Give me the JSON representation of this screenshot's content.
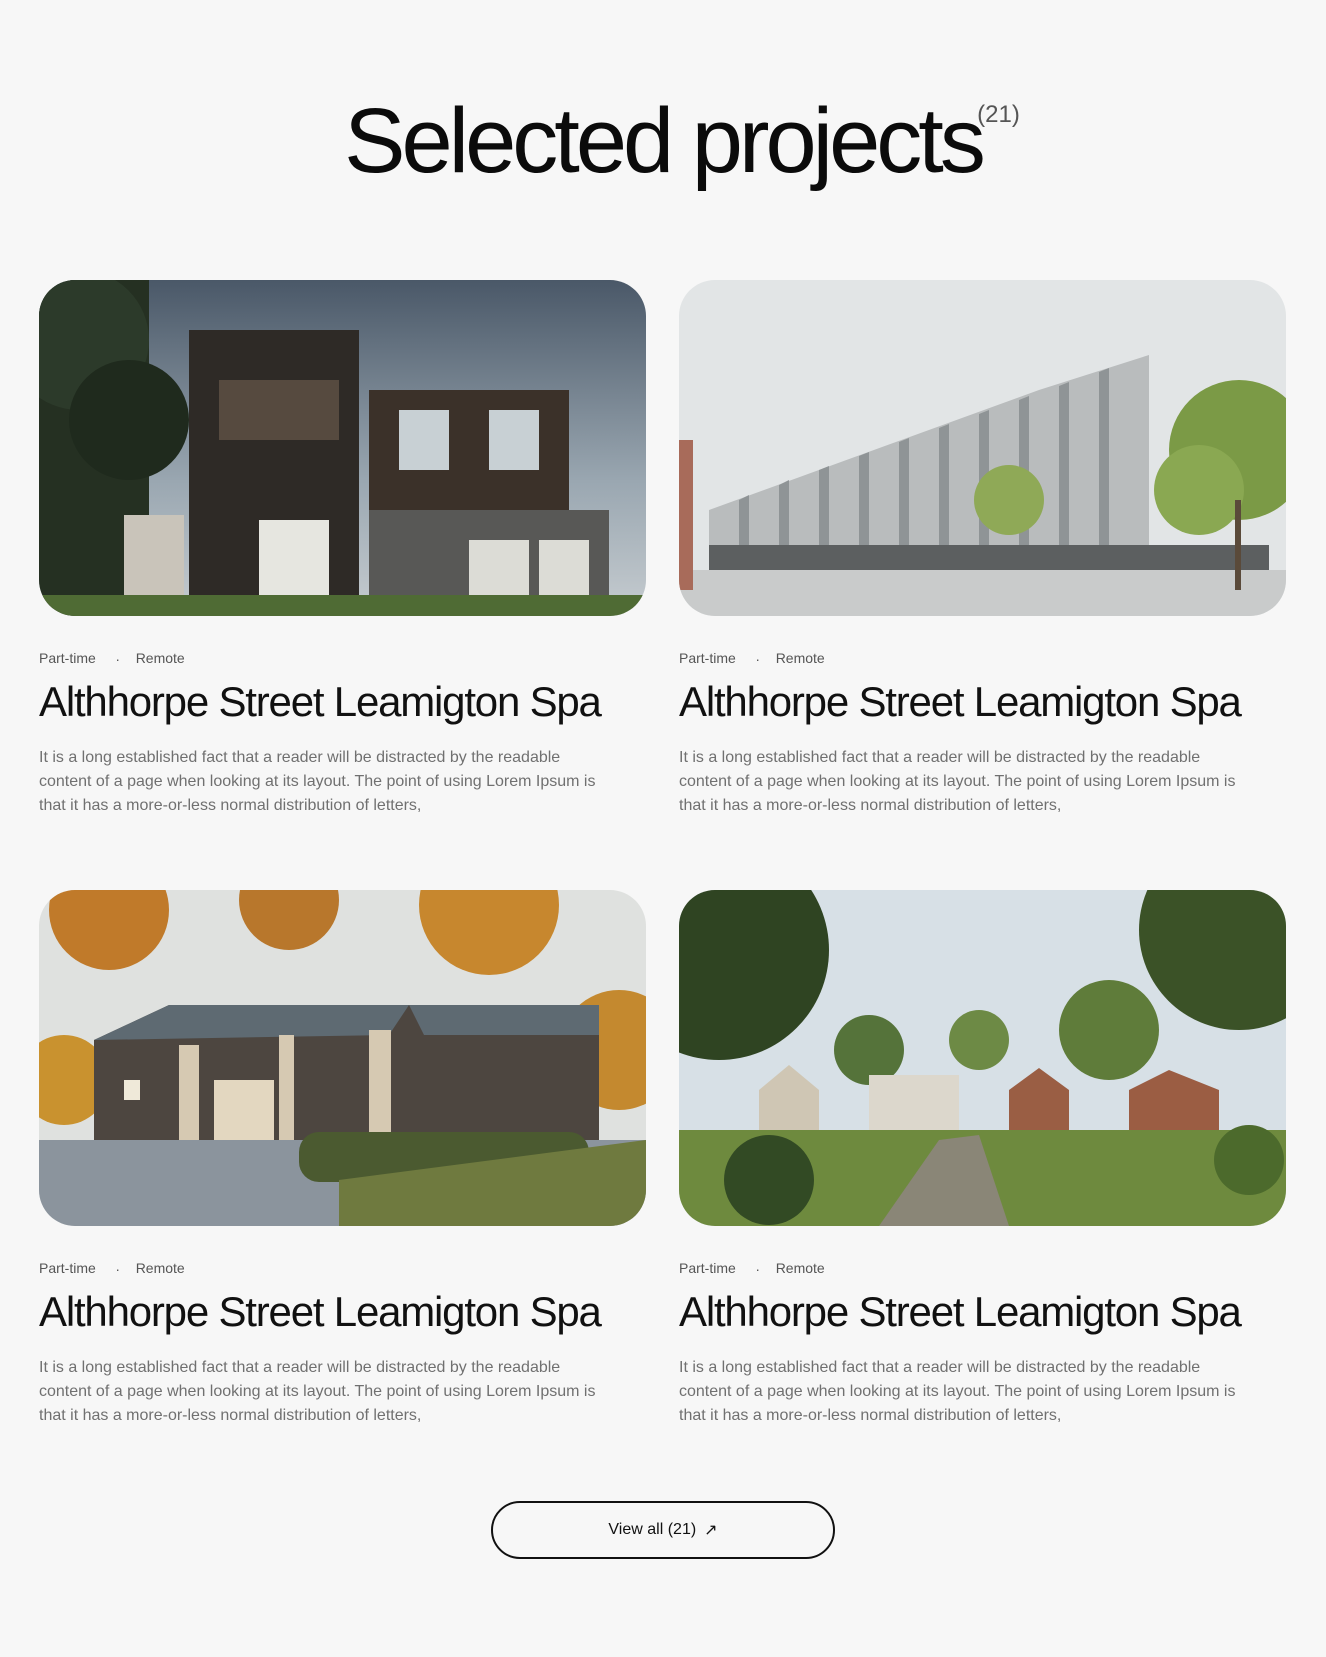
{
  "section": {
    "title": "Selected projects",
    "count": "(21)"
  },
  "projects": [
    {
      "type": "Part-time",
      "location": "Remote",
      "separator": ".",
      "title": "Althhorpe Street Leamigton Spa",
      "description": "It is a long established fact that a reader will be distracted by the readable content of a page when looking at its layout. The point of using Lorem Ipsum is that it has a more-or-less normal distribution of letters,",
      "image": "modern-dark-wood-house-render"
    },
    {
      "type": "Part-time",
      "location": "Remote",
      "separator": ".",
      "title": "Althhorpe Street Leamigton Spa",
      "description": "It is a long established fact that a reader will be distracted by the readable content of a page when looking at its layout. The point of using Lorem Ipsum is that it has a more-or-less normal distribution of letters,",
      "image": "white-facade-campus-building-render"
    },
    {
      "type": "Part-time",
      "location": "Remote",
      "separator": ".",
      "title": "Althhorpe Street Leamigton Spa",
      "description": "It is a long established fact that a reader will be distracted by the readable content of a page when looking at its layout. The point of using Lorem Ipsum is that it has a more-or-less normal distribution of letters,",
      "image": "timber-barn-houses-autumn-render"
    },
    {
      "type": "Part-time",
      "location": "Remote",
      "separator": ".",
      "title": "Althhorpe Street Leamigton Spa",
      "description": "It is a long established fact that a reader will be distracted by the readable content of a page when looking at its layout. The point of using Lorem Ipsum is that it has a more-or-less normal distribution of letters,",
      "image": "village-houses-green-lane-render"
    }
  ],
  "view_all": {
    "label": "View all (21)",
    "icon": "arrow-up-right-icon"
  }
}
